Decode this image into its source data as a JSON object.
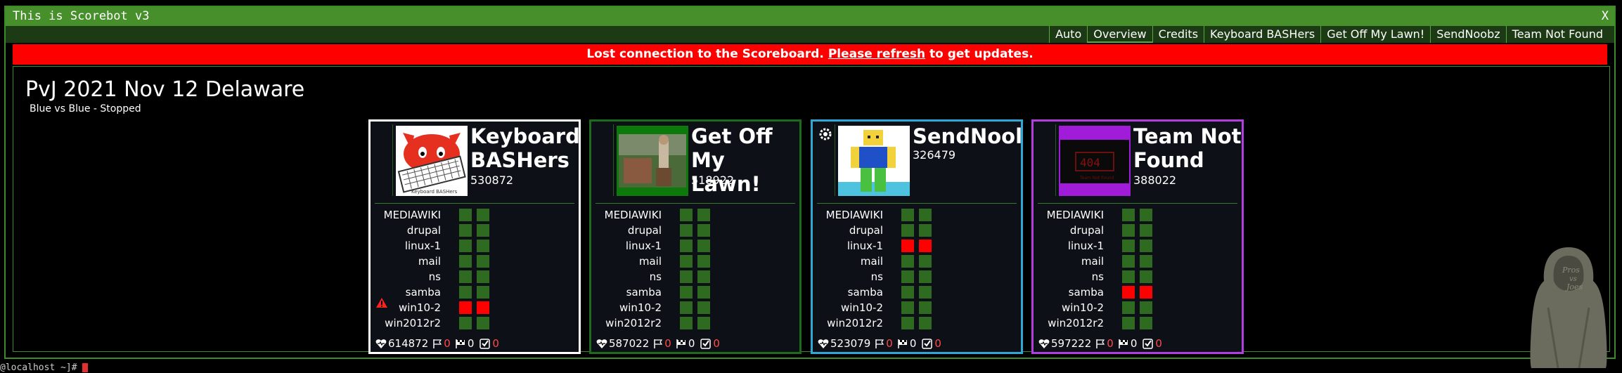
{
  "window": {
    "title": "This is Scorebot v3",
    "close_label": "X"
  },
  "menu": [
    "Auto",
    "Overview",
    "Credits",
    "Keyboard BASHers",
    "Get Off My Lawn!",
    "SendNoobz",
    "Team Not Found"
  ],
  "alert": {
    "before": "Lost connection to the Scoreboard. ",
    "link": "Please refresh",
    "after": " to get updates."
  },
  "event": {
    "title": "PvJ 2021 Nov 12 Delaware",
    "subtitle": "Blue vs Blue - Stopped"
  },
  "services": [
    "MEDIAWIKI",
    "drupal",
    "linux-1",
    "mail",
    "ns",
    "samba",
    "win10-2",
    "win2012r2"
  ],
  "colors": {
    "up": "#2e6b20",
    "down": "#ff0000"
  },
  "teams": [
    {
      "name_line1": "Keyboard",
      "name_line2": "BASHers",
      "score": "530872",
      "border": "#ffffff",
      "logo": "cat-keyboard",
      "down": [
        6
      ],
      "warn_row": 6,
      "health": "614872",
      "flags_lost": "0",
      "flags_captured": "0",
      "tasks": "0"
    },
    {
      "name_line1": "Get Off My",
      "name_line2": "Lawn!",
      "score": "518922",
      "border": "#1e6b1e",
      "logo": "lawn-photo",
      "down": [],
      "warn_row": -1,
      "health": "587022",
      "flags_lost": "0",
      "flags_captured": "0",
      "tasks": "0"
    },
    {
      "name_line1": "SendNool",
      "name_line2": "",
      "score": "326479",
      "border": "#2fa8d8",
      "logo": "blocky-avatar",
      "down": [
        2
      ],
      "warn_row": -1,
      "health": "523079",
      "flags_lost": "0",
      "flags_captured": "0",
      "tasks": "0"
    },
    {
      "name_line1": "Team Not",
      "name_line2": "Found",
      "score": "388022",
      "border": "#b23ee0",
      "logo": "404-dark",
      "down": [
        5
      ],
      "warn_row": -1,
      "health": "597222",
      "flags_lost": "0",
      "flags_captured": "0",
      "tasks": "0"
    }
  ],
  "watermark_text": "Pros vs Joes",
  "prompt": "@localhost ~]# "
}
